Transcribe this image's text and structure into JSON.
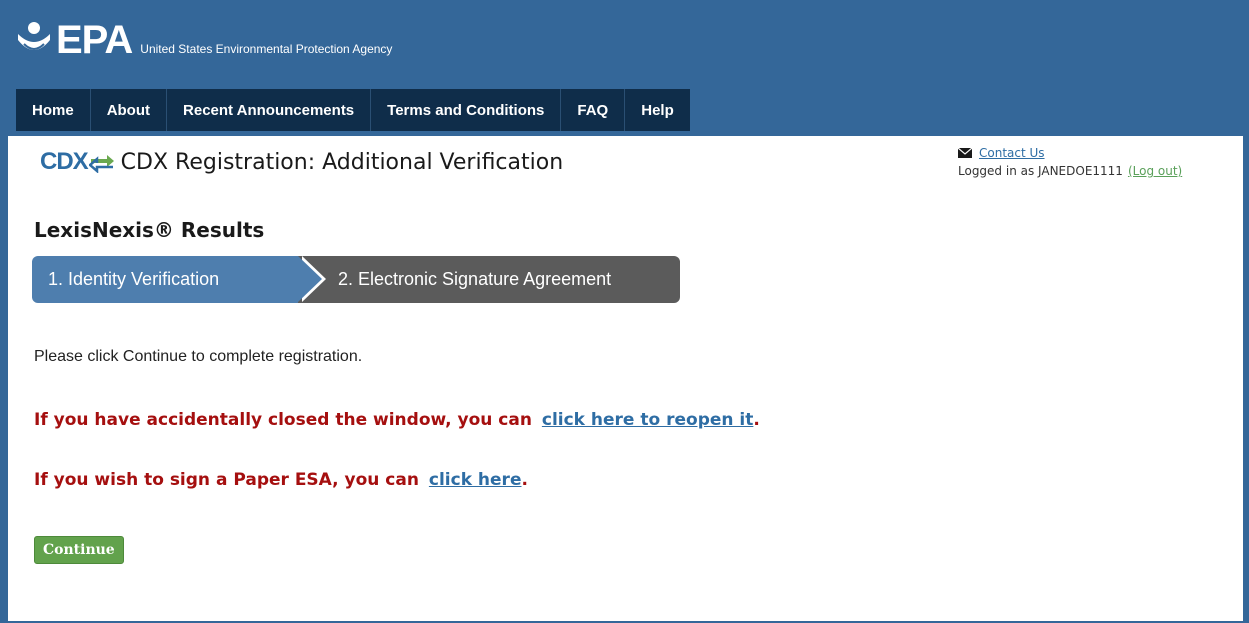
{
  "header": {
    "logo_text": "EPA",
    "agency_name": "United States Environmental Protection Agency"
  },
  "nav": {
    "items": [
      {
        "label": "Home"
      },
      {
        "label": "About"
      },
      {
        "label": "Recent Announcements"
      },
      {
        "label": "Terms and Conditions"
      },
      {
        "label": "FAQ"
      },
      {
        "label": "Help"
      }
    ]
  },
  "page": {
    "cdx_logo": "CDX",
    "title": "CDX Registration: Additional Verification"
  },
  "utility": {
    "contact_label": "Contact Us",
    "logged_in_prefix": "Logged in as JANEDOE1111",
    "logout_label": "(Log out)"
  },
  "section": {
    "heading": "LexisNexis® Results"
  },
  "steps": [
    {
      "label": "1. Identity Verification",
      "state": "active"
    },
    {
      "label": "2. Electronic Signature Agreement",
      "state": "inactive"
    }
  ],
  "content": {
    "instruction": "Please click Continue to complete registration.",
    "reopen_text": "If you have accidentally closed the window, you can",
    "reopen_link": "click here to reopen it",
    "paper_text": "If you wish to sign a Paper ESA, you can",
    "paper_link": "click here",
    "period": ".",
    "continue_label": "Continue"
  },
  "colors": {
    "header_bg": "#346799",
    "nav_bg": "#0f2d4a",
    "step_active": "#4e7eae",
    "step_inactive": "#5b5b5b",
    "warning_text": "#a50f0f",
    "link": "#2e6da4",
    "logout_link": "#5aa05a",
    "continue_button": "#62a24c"
  }
}
